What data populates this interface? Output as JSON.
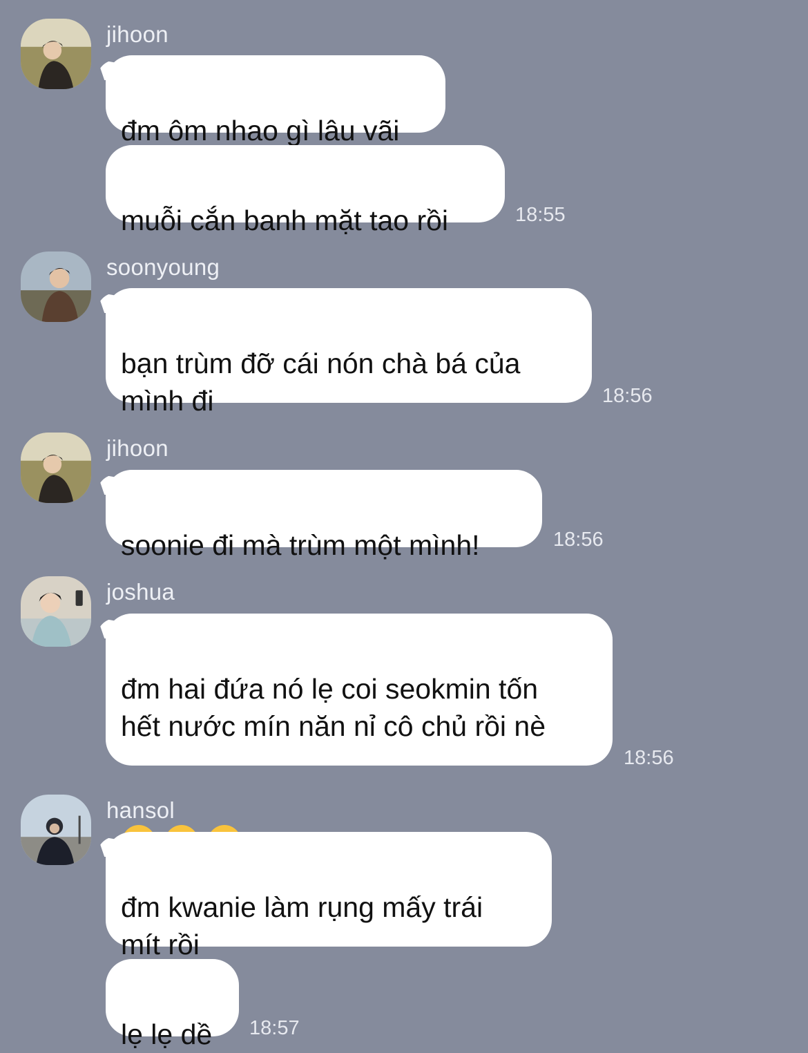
{
  "messages": [
    {
      "sender": "jihoon",
      "bubbles": [
        "đm ôm nhao gì lâu vãi",
        "muỗi cắn banh mặt tao rồi"
      ],
      "time": "18:55"
    },
    {
      "sender": "soonyoung",
      "bubbles": [
        "bạn trùm đỡ cái nón chà bá của\nmình đi"
      ],
      "time": "18:56"
    },
    {
      "sender": "jihoon",
      "bubbles": [
        "soonie đi mà trùm một mình!"
      ],
      "time": "18:56"
    },
    {
      "sender": "joshua",
      "bubbles": [
        "đm hai đứa nó lẹ coi seokmin tốn\nhết nước mín năn nỉ cô chủ rồi nè"
      ],
      "emojis": [
        "loudly-crying-face",
        "loudly-crying-face",
        "loudly-crying-face"
      ],
      "time": "18:56"
    },
    {
      "sender": "hansol",
      "bubbles": [
        "đm kwanie làm rụng mấy trái\nmít rồi",
        "lẹ lẹ dề"
      ],
      "time": "18:57"
    }
  ],
  "colors": {
    "background": "#858b9c",
    "bubble": "#ffffff",
    "text": "#111111",
    "meta_text": "#eef0f5"
  }
}
